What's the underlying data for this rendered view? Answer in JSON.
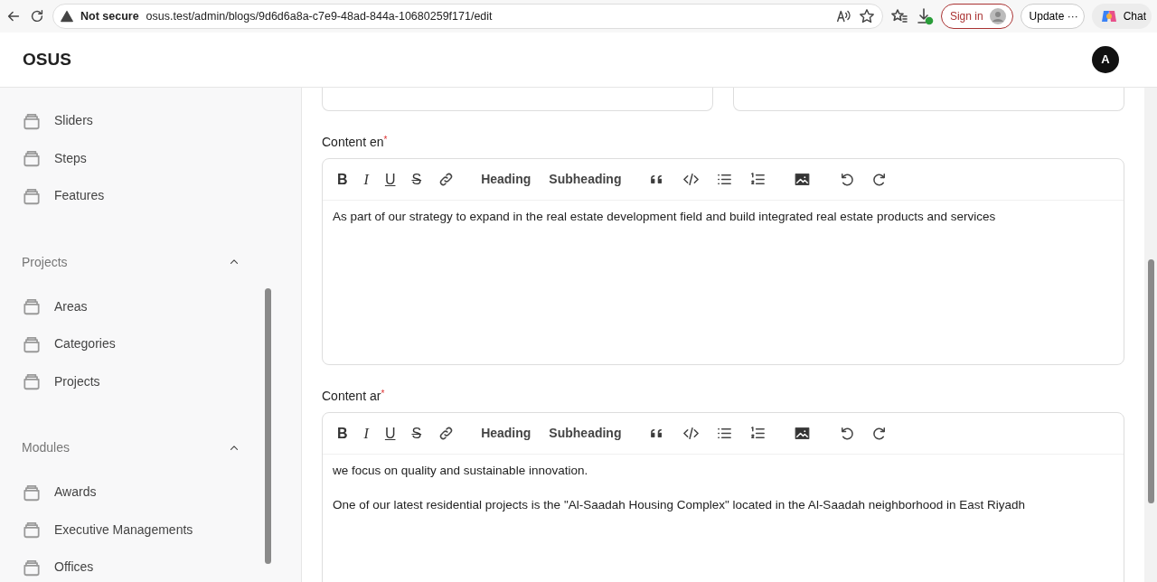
{
  "browser": {
    "security": "Not secure",
    "url": "osus.test/admin/blogs/9d6d6a8a-c7e9-48ad-844a-10680259f171/edit",
    "sign_in": "Sign in",
    "update": "Update",
    "update_more": "···",
    "chat": "Chat"
  },
  "header": {
    "brand": "OSUS",
    "avatar": "A"
  },
  "sidebar": {
    "groups": [
      {
        "items": [
          "Sliders",
          "Steps",
          "Features"
        ]
      },
      {
        "title": "Projects",
        "expanded": true,
        "items": [
          "Areas",
          "Categories",
          "Projects"
        ]
      },
      {
        "title": "Modules",
        "expanded": true,
        "items": [
          "Awards",
          "Executive Managements",
          "Offices"
        ]
      }
    ]
  },
  "editors": [
    {
      "label": "Content en",
      "required_mark": "*",
      "toolbar": [
        {
          "kind": "glyph",
          "text": "B"
        },
        {
          "kind": "glyph",
          "text": "I"
        },
        {
          "kind": "glyph",
          "text": "U"
        },
        {
          "kind": "glyph",
          "text": "S"
        },
        {
          "kind": "icon"
        },
        {
          "kind": "text",
          "text": "Heading"
        },
        {
          "kind": "text",
          "text": "Subheading"
        },
        {
          "kind": "icon"
        },
        {
          "kind": "icon"
        },
        {
          "kind": "icon"
        },
        {
          "kind": "icon"
        },
        {
          "kind": "icon"
        },
        {
          "kind": "icon"
        },
        {
          "kind": "icon"
        }
      ],
      "paragraphs": [
        "As part of our strategy to expand in the real estate development field and build integrated real estate products and services"
      ]
    },
    {
      "label": "Content ar",
      "required_mark": "*",
      "toolbar": [
        {
          "kind": "glyph",
          "text": "B"
        },
        {
          "kind": "glyph",
          "text": "I"
        },
        {
          "kind": "glyph",
          "text": "U"
        },
        {
          "kind": "glyph",
          "text": "S"
        },
        {
          "kind": "icon"
        },
        {
          "kind": "text",
          "text": "Heading"
        },
        {
          "kind": "text",
          "text": "Subheading"
        },
        {
          "kind": "icon"
        },
        {
          "kind": "icon"
        },
        {
          "kind": "icon"
        },
        {
          "kind": "icon"
        },
        {
          "kind": "icon"
        },
        {
          "kind": "icon"
        },
        {
          "kind": "icon"
        }
      ],
      "paragraphs": [
        "we focus on quality and sustainable innovation.",
        "One of our latest residential projects is the \"Al-Saadah Housing Complex\" located in the Al-Saadah neighborhood in East Riyadh"
      ]
    }
  ]
}
